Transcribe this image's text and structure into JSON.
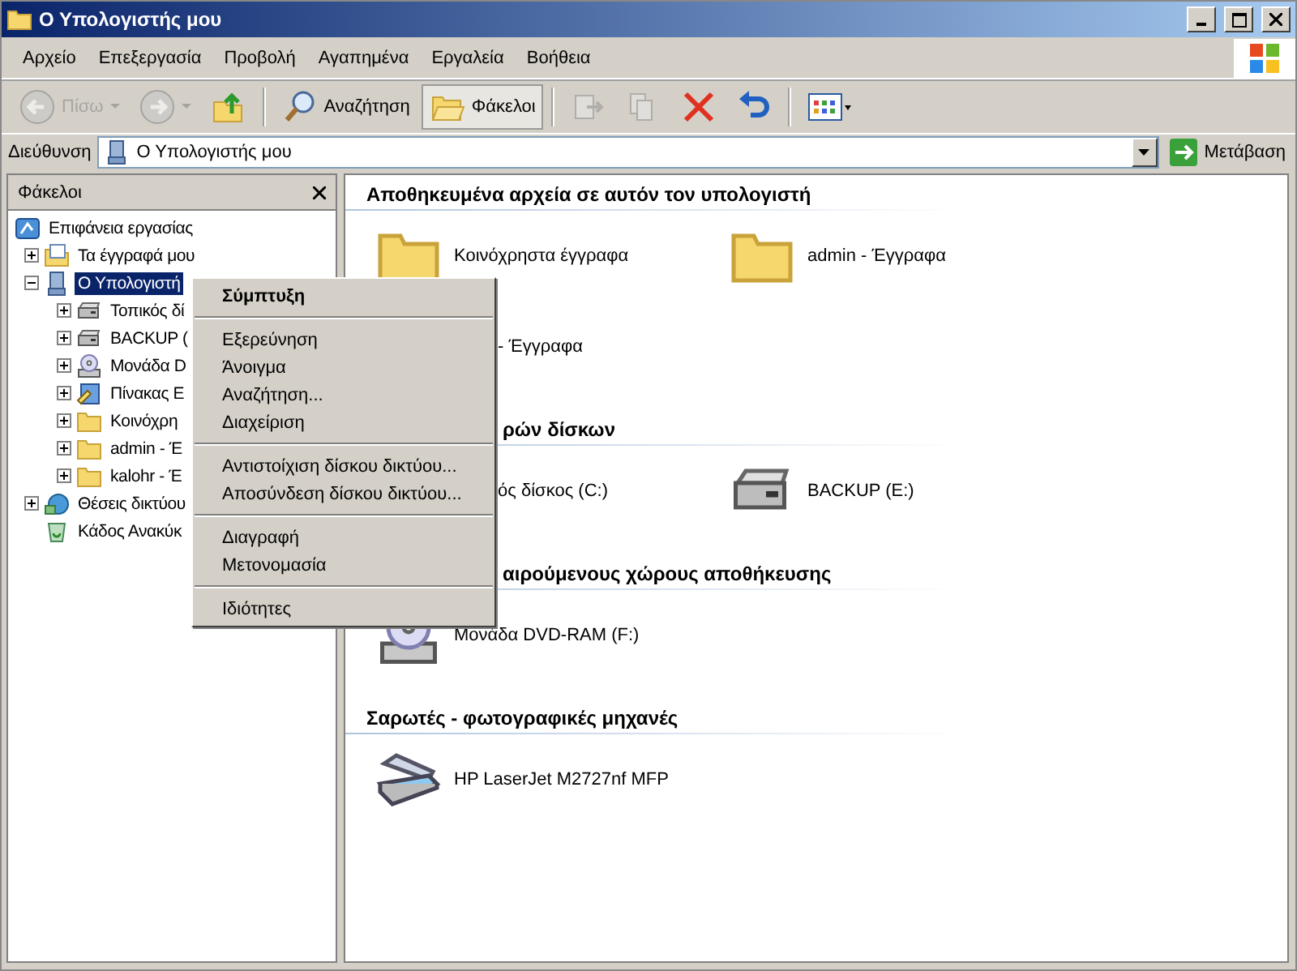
{
  "window": {
    "title": "Ο Υπολογιστής μου"
  },
  "menu_bar": [
    "Αρχείο",
    "Επεξεργασία",
    "Προβολή",
    "Αγαπημένα",
    "Εργαλεία",
    "Βοήθεια"
  ],
  "toolbar": [
    {
      "kind": "back",
      "label": "Πίσω",
      "disabled": true
    },
    {
      "kind": "forward",
      "disabled": true
    },
    {
      "kind": "up",
      "disabled": false
    },
    {
      "kind": "search",
      "label": "Αναζήτηση",
      "selected": false
    },
    {
      "kind": "folders",
      "label": "Φάκελοι",
      "selected": true
    },
    {
      "kind": "move",
      "disabled": true
    },
    {
      "kind": "copy",
      "disabled": true
    },
    {
      "kind": "delete",
      "disabled": false
    },
    {
      "kind": "undo",
      "disabled": false
    },
    {
      "kind": "views",
      "disabled": false
    }
  ],
  "address_bar": {
    "label": "Διεύθυνση",
    "value": "Ο Υπολογιστής μου",
    "go": "Μετάβαση"
  },
  "folders_pane": {
    "title": "Φάκελοι",
    "tree": [
      {
        "label": "Επιφάνεια εργασίας",
        "kind": "desktop",
        "selected": false,
        "children": [
          {
            "label": "Τα έγγραφά μου",
            "kind": "documents",
            "expanded": false,
            "selected": false
          },
          {
            "label": "Ο Υπολογιστή",
            "kind": "computer",
            "expanded": true,
            "selected": true,
            "children": [
              {
                "label": "Τοπικός δί",
                "kind": "drive",
                "expanded": false,
                "selected": false
              },
              {
                "label": "BACKUP (",
                "kind": "drive",
                "expanded": false,
                "selected": false
              },
              {
                "label": "Μονάδα D",
                "kind": "dvd",
                "expanded": false,
                "selected": false
              },
              {
                "label": "Πίνακας Ε",
                "kind": "panel",
                "expanded": false,
                "selected": false
              },
              {
                "label": "Κοινόχρη",
                "kind": "folder",
                "expanded": false,
                "selected": false
              },
              {
                "label": "admin - Έ",
                "kind": "folder",
                "expanded": false,
                "selected": false
              },
              {
                "label": "kalohr - Έ",
                "kind": "folder",
                "expanded": false,
                "selected": false
              }
            ]
          },
          {
            "label": "Θέσεις δικτύου",
            "kind": "network",
            "expanded": false,
            "selected": false
          },
          {
            "label": "Κάδος Ανακύκ",
            "kind": "recycle",
            "selected": false
          }
        ]
      }
    ]
  },
  "content": {
    "sections": [
      {
        "title": "Αποθηκευμένα αρχεία σε αυτόν τον υπολογιστή",
        "kind": "full",
        "items": [
          {
            "label": "Κοινόχρηστα έγγραφα",
            "kind": "folder"
          },
          {
            "label": "admin - Έγγραφα",
            "kind": "folder"
          },
          {
            "label": "- Έγγραφα",
            "kind": "covered"
          }
        ]
      },
      {
        "title": "ρών δίσκων",
        "kind": "covered",
        "items": [
          {
            "label": "ός δίσκος (C:)",
            "kind": "covered"
          },
          {
            "label": "BACKUP (E:)",
            "kind": "drive"
          }
        ]
      },
      {
        "title": "αιρούμενους χώρους αποθήκευσης",
        "kind": "covered",
        "items": [
          {
            "label": "Μονάδα DVD-RAM (F:)",
            "kind": "dvd"
          }
        ]
      },
      {
        "title": "Σαρωτές - φωτογραφικές μηχανές",
        "kind": "full",
        "items": [
          {
            "label": "HP LaserJet M2727nf MFP",
            "kind": "scanner"
          }
        ]
      }
    ]
  },
  "context_menu": [
    {
      "kind": "default",
      "label": "Σύμπτυξη"
    },
    {
      "kind": "separator"
    },
    {
      "kind": "item",
      "label": "Εξερεύνηση"
    },
    {
      "kind": "item",
      "label": "Άνοιγμα"
    },
    {
      "kind": "item",
      "label": "Αναζήτηση..."
    },
    {
      "kind": "item",
      "label": "Διαχείριση"
    },
    {
      "kind": "separator"
    },
    {
      "kind": "item",
      "label": "Αντιστοίχιση δίσκου δικτύου..."
    },
    {
      "kind": "item",
      "label": "Αποσύνδεση δίσκου δικτύου..."
    },
    {
      "kind": "separator"
    },
    {
      "kind": "item",
      "label": "Διαγραφή"
    },
    {
      "kind": "item",
      "label": "Μετονομασία"
    },
    {
      "kind": "separator"
    },
    {
      "kind": "item",
      "label": "Ιδιότητες"
    }
  ]
}
